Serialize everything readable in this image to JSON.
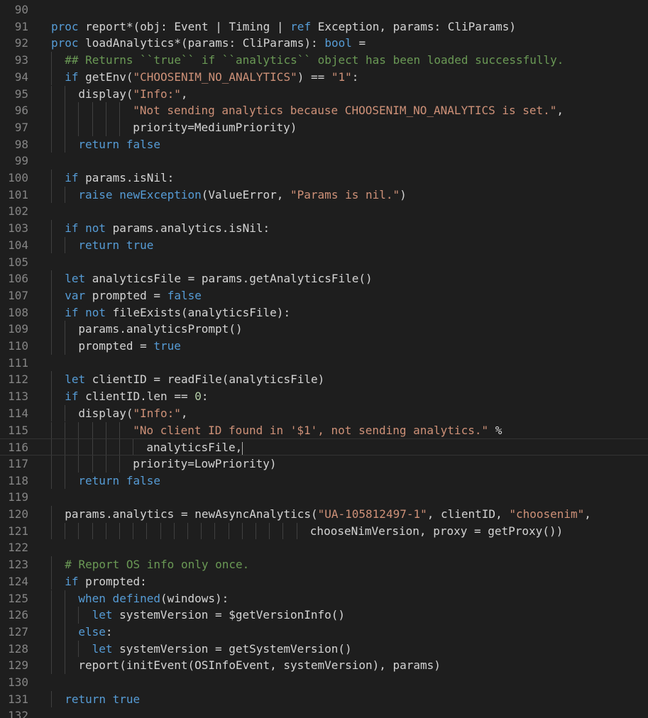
{
  "editor": {
    "lines": [
      {
        "n": "90",
        "tokens": []
      },
      {
        "n": "91",
        "tokens": [
          [
            "kw",
            "proc"
          ],
          [
            "p",
            " report"
          ],
          [
            "op",
            "*"
          ],
          [
            "p",
            "(obj: Event | Timing | "
          ],
          [
            "kw",
            "ref"
          ],
          [
            "p",
            " Exception, params: CliParams)"
          ]
        ]
      },
      {
        "n": "92",
        "tokens": [
          [
            "kw",
            "proc"
          ],
          [
            "p",
            " loadAnalytics"
          ],
          [
            "op",
            "*"
          ],
          [
            "p",
            "(params: CliParams): "
          ],
          [
            "kw",
            "bool"
          ],
          [
            "p",
            " ="
          ]
        ]
      },
      {
        "n": "93",
        "indent": 1,
        "tokens": [
          [
            "cm",
            "## Returns ``true`` if ``analytics`` object has been loaded successfully."
          ]
        ]
      },
      {
        "n": "94",
        "indent": 1,
        "tokens": [
          [
            "kw",
            "if"
          ],
          [
            "p",
            " getEnv("
          ],
          [
            "str",
            "\"CHOOSENIM_NO_ANALYTICS\""
          ],
          [
            "p",
            ") == "
          ],
          [
            "str",
            "\"1\""
          ],
          [
            "p",
            ":"
          ]
        ]
      },
      {
        "n": "95",
        "indent": 2,
        "tokens": [
          [
            "p",
            "display("
          ],
          [
            "str",
            "\"Info:\""
          ],
          [
            "p",
            ","
          ]
        ]
      },
      {
        "n": "96",
        "indent": 6,
        "tokens": [
          [
            "str",
            "\"Not sending analytics because CHOOSENIM_NO_ANALYTICS is set.\""
          ],
          [
            "p",
            ","
          ]
        ]
      },
      {
        "n": "97",
        "indent": 6,
        "tokens": [
          [
            "p",
            "priority=MediumPriority)"
          ]
        ]
      },
      {
        "n": "98",
        "indent": 2,
        "tokens": [
          [
            "kw",
            "return false"
          ]
        ]
      },
      {
        "n": "99",
        "tokens": []
      },
      {
        "n": "100",
        "indent": 1,
        "tokens": [
          [
            "kw",
            "if"
          ],
          [
            "p",
            " params.isNil:"
          ]
        ]
      },
      {
        "n": "101",
        "indent": 2,
        "tokens": [
          [
            "kw",
            "raise newException"
          ],
          [
            "p",
            "(ValueError, "
          ],
          [
            "str",
            "\"Params is nil.\""
          ],
          [
            "p",
            ")"
          ]
        ]
      },
      {
        "n": "102",
        "tokens": []
      },
      {
        "n": "103",
        "indent": 1,
        "tokens": [
          [
            "kw",
            "if not"
          ],
          [
            "p",
            " params.analytics.isNil:"
          ]
        ]
      },
      {
        "n": "104",
        "indent": 2,
        "tokens": [
          [
            "kw",
            "return true"
          ]
        ]
      },
      {
        "n": "105",
        "tokens": []
      },
      {
        "n": "106",
        "indent": 1,
        "tokens": [
          [
            "kw",
            "let"
          ],
          [
            "p",
            " analyticsFile = params.getAnalyticsFile()"
          ]
        ]
      },
      {
        "n": "107",
        "indent": 1,
        "tokens": [
          [
            "kw",
            "var"
          ],
          [
            "p",
            " prompted = "
          ],
          [
            "kw",
            "false"
          ]
        ]
      },
      {
        "n": "108",
        "indent": 1,
        "tokens": [
          [
            "kw",
            "if not"
          ],
          [
            "p",
            " fileExists(analyticsFile):"
          ]
        ]
      },
      {
        "n": "109",
        "indent": 2,
        "tokens": [
          [
            "p",
            "params.analyticsPrompt()"
          ]
        ]
      },
      {
        "n": "110",
        "indent": 2,
        "tokens": [
          [
            "p",
            "prompted = "
          ],
          [
            "kw",
            "true"
          ]
        ]
      },
      {
        "n": "111",
        "tokens": []
      },
      {
        "n": "112",
        "indent": 1,
        "tokens": [
          [
            "kw",
            "let"
          ],
          [
            "p",
            " clientID = readFile(analyticsFile)"
          ]
        ]
      },
      {
        "n": "113",
        "indent": 1,
        "tokens": [
          [
            "kw",
            "if"
          ],
          [
            "p",
            " clientID.len == "
          ],
          [
            "num",
            "0"
          ],
          [
            "p",
            ":"
          ]
        ]
      },
      {
        "n": "114",
        "indent": 2,
        "tokens": [
          [
            "p",
            "display("
          ],
          [
            "str",
            "\"Info:\""
          ],
          [
            "p",
            ","
          ]
        ]
      },
      {
        "n": "115",
        "indent": 6,
        "tokens": [
          [
            "str",
            "\"No client ID found in '$1', not sending analytics.\""
          ],
          [
            "p",
            " %"
          ]
        ]
      },
      {
        "n": "116",
        "indent": 7,
        "current": true,
        "tokens": [
          [
            "p",
            "analyticsFile,"
          ]
        ]
      },
      {
        "n": "117",
        "indent": 6,
        "tokens": [
          [
            "p",
            "priority=LowPriority)"
          ]
        ]
      },
      {
        "n": "118",
        "indent": 2,
        "tokens": [
          [
            "kw",
            "return false"
          ]
        ]
      },
      {
        "n": "119",
        "tokens": []
      },
      {
        "n": "120",
        "indent": 1,
        "tokens": [
          [
            "p",
            "params.analytics = newAsyncAnalytics("
          ],
          [
            "str",
            "\"UA-105812497-1\""
          ],
          [
            "p",
            ", clientID, "
          ],
          [
            "str",
            "\"choosenim\""
          ],
          [
            "p",
            ","
          ]
        ]
      },
      {
        "n": "121",
        "indent": 19,
        "tokens": [
          [
            "p",
            "chooseNimVersion, proxy = getProxy())"
          ]
        ]
      },
      {
        "n": "122",
        "tokens": []
      },
      {
        "n": "123",
        "indent": 1,
        "tokens": [
          [
            "cm",
            "# Report OS info only once."
          ]
        ]
      },
      {
        "n": "124",
        "indent": 1,
        "tokens": [
          [
            "kw",
            "if"
          ],
          [
            "p",
            " prompted:"
          ]
        ]
      },
      {
        "n": "125",
        "indent": 2,
        "tokens": [
          [
            "kw",
            "when defined"
          ],
          [
            "p",
            "(windows):"
          ]
        ]
      },
      {
        "n": "126",
        "indent": 3,
        "tokens": [
          [
            "kw",
            "let"
          ],
          [
            "p",
            " systemVersion = $getVersionInfo()"
          ]
        ]
      },
      {
        "n": "127",
        "indent": 2,
        "tokens": [
          [
            "kw",
            "else"
          ],
          [
            "p",
            ":"
          ]
        ]
      },
      {
        "n": "128",
        "indent": 3,
        "tokens": [
          [
            "kw",
            "let"
          ],
          [
            "p",
            " systemVersion = getSystemVersion()"
          ]
        ]
      },
      {
        "n": "129",
        "indent": 2,
        "tokens": [
          [
            "p",
            "report(initEvent(OSInfoEvent, systemVersion), params)"
          ]
        ]
      },
      {
        "n": "130",
        "tokens": []
      },
      {
        "n": "131",
        "indent": 1,
        "tokens": [
          [
            "kw",
            "return true"
          ]
        ]
      },
      {
        "n": "132",
        "tokens": []
      }
    ]
  }
}
